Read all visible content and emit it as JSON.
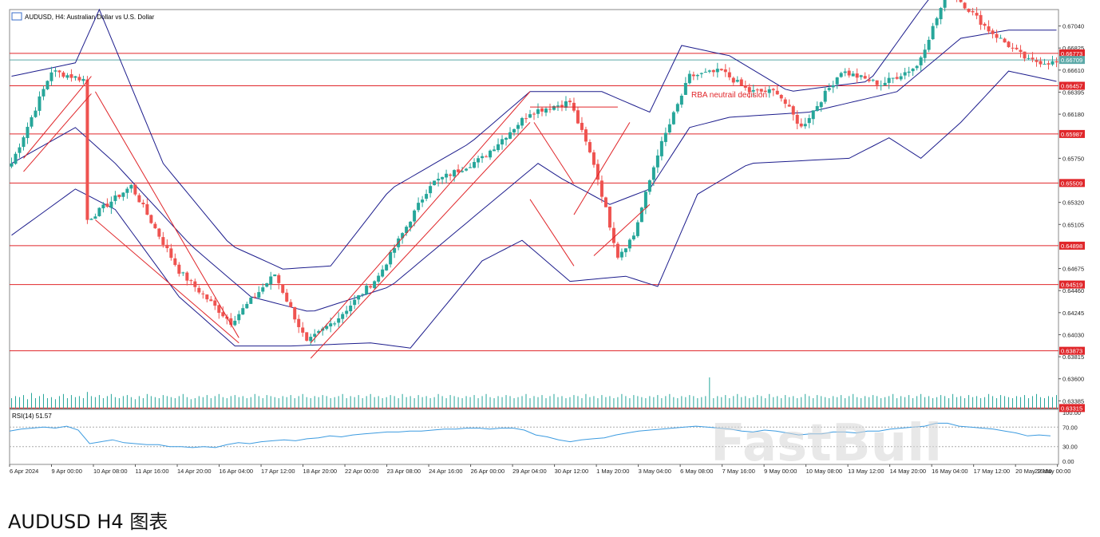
{
  "caption": "AUDUSD H4 图表",
  "watermark": "FastBull",
  "chart_data": {
    "type": "candlestick",
    "symbol_title": "AUDUSD, H4:  Australian Dollar vs U.S. Dollar",
    "price_axis_labels": [
      "0.67040",
      "0.66825",
      "0.66610",
      "0.66395",
      "0.66180",
      "0.65750",
      "0.65320",
      "0.65105",
      "0.64675",
      "0.64460",
      "0.64245",
      "0.64030",
      "0.63815",
      "0.63600",
      "0.63385"
    ],
    "price_tags": [
      {
        "value": "0.66773",
        "kind": "level",
        "color": "#e0262a"
      },
      {
        "value": "0.66709",
        "kind": "current",
        "color": "#5ca9a8"
      },
      {
        "value": "0.66457",
        "kind": "level",
        "color": "#e0262a"
      },
      {
        "value": "0.65987",
        "kind": "level",
        "color": "#e0262a"
      },
      {
        "value": "0.65509",
        "kind": "level",
        "color": "#e0262a"
      },
      {
        "value": "0.64898",
        "kind": "level",
        "color": "#e0262a"
      },
      {
        "value": "0.64519",
        "kind": "level",
        "color": "#e0262a"
      },
      {
        "value": "0.63873",
        "kind": "level",
        "color": "#e0262a"
      },
      {
        "value": "0.63315",
        "kind": "level",
        "color": "#e0262a"
      }
    ],
    "ylim": [
      0.6331,
      0.672
    ],
    "time_labels": [
      "6 Apr 2024",
      "9 Apr 00:00",
      "10 Apr 08:00",
      "11 Apr 16:00",
      "14 Apr 20:00",
      "16 Apr 04:00",
      "17 Apr 12:00",
      "18 Apr 20:00",
      "22 Apr 00:00",
      "23 Apr 08:00",
      "24 Apr 16:00",
      "26 Apr 00:00",
      "29 Apr 04:00",
      "30 Apr 12:00",
      "1 May 20:00",
      "3 May 04:00",
      "6 May 08:00",
      "7 May 16:00",
      "9 May 00:00",
      "10 May 08:00",
      "13 May 12:00",
      "14 May 20:00",
      "16 May 04:00",
      "17 May 12:00",
      "20 May 16:00",
      "22 May 00:00"
    ],
    "annotation": "RBA neutrail decision",
    "colors": {
      "bull": "#26a69a",
      "bear": "#ef5350",
      "bands": "#1c1c8c",
      "levels": "#e0262a",
      "rsi": "#3c9be0",
      "volume": "#26a69a"
    },
    "close_path": [
      [
        0,
        0.657
      ],
      [
        10,
        0.666
      ],
      [
        18,
        0.6652
      ],
      [
        19,
        0.6515
      ],
      [
        30,
        0.6548
      ],
      [
        42,
        0.6465
      ],
      [
        55,
        0.6415
      ],
      [
        66,
        0.6462
      ],
      [
        74,
        0.6395
      ],
      [
        82,
        0.642
      ],
      [
        92,
        0.646
      ],
      [
        105,
        0.655
      ],
      [
        118,
        0.6575
      ],
      [
        130,
        0.662
      ],
      [
        140,
        0.663
      ],
      [
        146,
        0.657
      ],
      [
        152,
        0.648
      ],
      [
        156,
        0.65
      ],
      [
        162,
        0.658
      ],
      [
        170,
        0.6655
      ],
      [
        178,
        0.666
      ],
      [
        185,
        0.664
      ],
      [
        192,
        0.664
      ],
      [
        198,
        0.6605
      ],
      [
        208,
        0.666
      ],
      [
        218,
        0.6647
      ],
      [
        227,
        0.6665
      ],
      [
        235,
        0.674
      ],
      [
        245,
        0.67
      ],
      [
        255,
        0.667
      ],
      [
        262,
        0.6668
      ]
    ],
    "bollinger": {
      "upper": [
        [
          0,
          0.6655
        ],
        [
          16,
          0.6668
        ],
        [
          22,
          0.672
        ],
        [
          38,
          0.657
        ],
        [
          55,
          0.649
        ],
        [
          68,
          0.6467
        ],
        [
          80,
          0.647
        ],
        [
          95,
          0.6545
        ],
        [
          115,
          0.659
        ],
        [
          130,
          0.664
        ],
        [
          140,
          0.664
        ],
        [
          148,
          0.664
        ],
        [
          160,
          0.662
        ],
        [
          168,
          0.6685
        ],
        [
          180,
          0.6675
        ],
        [
          195,
          0.664
        ],
        [
          215,
          0.665
        ],
        [
          228,
          0.672
        ],
        [
          236,
          0.676
        ],
        [
          250,
          0.6755
        ],
        [
          262,
          0.6752
        ]
      ],
      "middle": [
        [
          0,
          0.657
        ],
        [
          16,
          0.6605
        ],
        [
          26,
          0.657
        ],
        [
          45,
          0.649
        ],
        [
          60,
          0.644
        ],
        [
          75,
          0.6425
        ],
        [
          95,
          0.645
        ],
        [
          115,
          0.6515
        ],
        [
          132,
          0.657
        ],
        [
          138,
          0.6555
        ],
        [
          150,
          0.653
        ],
        [
          160,
          0.6545
        ],
        [
          170,
          0.6605
        ],
        [
          180,
          0.6615
        ],
        [
          200,
          0.662
        ],
        [
          222,
          0.664
        ],
        [
          238,
          0.6692
        ],
        [
          250,
          0.67
        ],
        [
          262,
          0.67
        ]
      ],
      "lower": [
        [
          0,
          0.65
        ],
        [
          16,
          0.6545
        ],
        [
          26,
          0.6525
        ],
        [
          42,
          0.644
        ],
        [
          56,
          0.6392
        ],
        [
          70,
          0.6392
        ],
        [
          90,
          0.6395
        ],
        [
          100,
          0.639
        ],
        [
          118,
          0.6475
        ],
        [
          128,
          0.6495
        ],
        [
          140,
          0.6455
        ],
        [
          154,
          0.646
        ],
        [
          162,
          0.645
        ],
        [
          172,
          0.654
        ],
        [
          185,
          0.657
        ],
        [
          210,
          0.6575
        ],
        [
          220,
          0.6595
        ],
        [
          228,
          0.6575
        ],
        [
          238,
          0.661
        ],
        [
          250,
          0.666
        ],
        [
          262,
          0.665
        ]
      ]
    },
    "volumes": [
      10,
      12,
      11,
      13,
      9,
      15,
      10,
      12,
      14,
      10,
      11,
      9,
      12,
      14,
      10,
      13,
      11,
      12,
      10,
      16,
      12,
      11,
      13,
      10,
      12,
      14,
      11,
      10,
      12,
      13,
      11,
      9,
      12,
      10,
      14,
      12,
      11,
      10,
      13,
      12,
      11,
      10,
      12,
      14,
      11,
      9,
      10,
      12,
      11,
      13,
      10,
      12,
      14,
      11,
      10,
      12,
      13,
      11,
      12,
      10,
      11,
      14,
      12,
      10,
      13,
      12,
      11,
      10,
      12,
      11,
      13,
      10,
      12,
      14,
      11,
      10,
      12,
      11,
      13,
      12,
      10,
      11,
      12,
      14,
      10,
      12,
      11,
      13,
      10,
      12,
      14,
      11,
      12,
      10,
      11,
      13,
      12,
      10,
      14,
      11,
      12,
      10,
      13,
      11,
      12,
      10,
      11,
      14,
      12,
      10,
      13,
      12,
      11,
      10,
      12,
      11,
      13,
      10,
      12,
      14,
      11,
      10,
      12,
      11,
      13,
      12,
      10,
      11,
      12,
      14,
      10,
      12,
      11,
      13,
      10,
      12,
      14,
      11,
      12,
      10,
      11,
      13,
      12,
      10,
      14,
      11,
      12,
      10,
      13,
      11,
      12,
      10,
      11,
      14,
      12,
      10,
      13,
      12,
      11,
      10,
      12,
      11,
      13,
      10,
      12,
      14,
      11,
      10,
      12,
      11,
      13,
      12,
      10,
      11,
      12,
      30,
      10,
      12,
      11,
      13,
      10,
      12,
      14,
      11,
      12,
      10,
      11,
      13,
      12,
      10,
      14,
      11,
      12,
      10,
      13,
      11,
      12,
      10,
      11,
      14,
      12,
      10,
      13,
      12,
      11,
      10,
      12,
      11,
      13,
      10,
      12,
      14,
      11,
      10,
      12,
      11,
      13,
      12,
      10,
      11,
      12,
      14,
      10,
      12,
      11,
      13,
      10,
      12,
      14,
      11,
      12,
      10,
      11,
      13,
      12,
      10,
      14,
      11,
      12,
      10,
      13,
      11,
      12,
      10,
      11,
      14,
      12,
      10,
      13,
      12,
      11,
      10,
      12,
      11,
      13,
      10,
      12,
      14,
      11,
      10,
      12,
      11,
      13,
      12,
      10,
      11,
      12,
      14,
      10,
      12,
      11,
      13
    ],
    "rsi": {
      "label": "RSI(14) 51.57",
      "value": 51.57,
      "levels": [
        70,
        30
      ],
      "axis_labels": [
        "100.00",
        "70.00",
        "30.00",
        "0.00"
      ],
      "values": [
        62,
        66,
        68,
        70,
        68,
        72,
        64,
        36,
        40,
        44,
        38,
        36,
        34,
        34,
        30,
        30,
        28,
        30,
        28,
        34,
        38,
        36,
        40,
        42,
        44,
        42,
        46,
        48,
        52,
        50,
        54,
        56,
        58,
        60,
        60,
        62,
        62,
        64,
        66,
        66,
        68,
        68,
        66,
        68,
        68,
        64,
        54,
        50,
        44,
        40,
        44,
        46,
        48,
        54,
        58,
        62,
        64,
        66,
        68,
        70,
        72,
        70,
        68,
        66,
        62,
        60,
        64,
        62,
        58,
        54,
        56,
        56,
        60,
        60,
        58,
        62,
        62,
        66,
        68,
        70,
        72,
        78,
        78,
        72,
        70,
        68,
        66,
        62,
        58,
        52,
        54,
        52
      ]
    }
  }
}
